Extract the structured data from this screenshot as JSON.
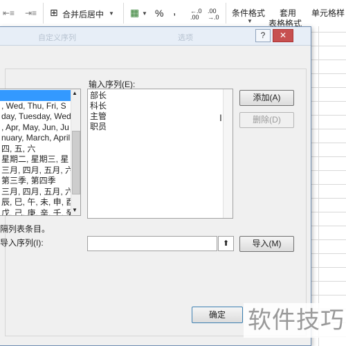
{
  "ribbon": {
    "merge_center_label": "合并后居中",
    "percent": "%",
    "comma": ",",
    "conditional_format_label": "条件格式",
    "format_as_table_top": "套用",
    "format_as_table_bottom": "表格格式",
    "cell_styles_label": "单元格样"
  },
  "dialog": {
    "title_left": "自定义序列",
    "title_right": "选项",
    "help_label": "?",
    "close_label": "✕",
    "input_sequence_label": "输入序列(E):",
    "existing_lists": [
      "",
      ", Wed, Thu, Fri, S",
      "day, Tuesday, Wed",
      ", Apr, May, Jun, Ju",
      "nuary, March, April",
      "四, 五, 六",
      "星期二, 星期三, 星",
      "三月, 四月, 五月, 六月,",
      "第三季, 第四季",
      "三月, 四月, 五月, 六月",
      "辰, 巳, 午, 未, 申, 酉",
      "戊, 己, 庚, 辛, 壬, 癸"
    ],
    "entries": [
      "部长",
      "科长",
      "主管",
      "职员"
    ],
    "add_button": "添加(A)",
    "delete_button": "删除(D)",
    "separator_hint": "隔列表条目。",
    "import_label": "导入序列(I):",
    "import_value": "",
    "import_button": "导入(M)",
    "ok_button": "确定"
  },
  "watermark": "软件技巧"
}
